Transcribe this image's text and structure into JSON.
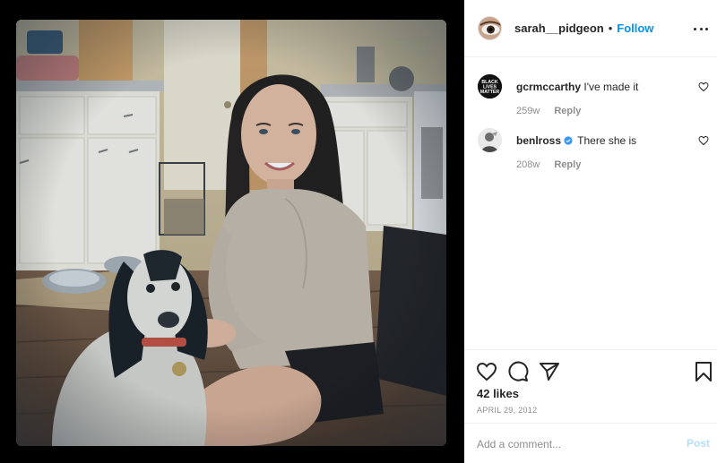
{
  "post": {
    "username": "sarah__pidgeon",
    "separator": "•",
    "follow_label": "Follow",
    "likes": "42 likes",
    "date": "APRIL 29, 2012"
  },
  "comments": [
    {
      "username": "gcrmccarthy",
      "text": "I've made it",
      "time": "259w",
      "reply_label": "Reply",
      "avatar_text": [
        "BLACK",
        "LIVES",
        "MATTER"
      ]
    },
    {
      "username": "benlross",
      "text": "There she is",
      "time": "208w",
      "reply_label": "Reply",
      "verified": true
    }
  ],
  "composer": {
    "placeholder": "Add a comment...",
    "post_label": "Post"
  },
  "icons": {
    "like": "heart-icon",
    "comment": "comment-icon",
    "share": "share-icon",
    "save": "bookmark-icon",
    "more": "more-options-icon",
    "verified": "verified-badge-icon"
  },
  "colors": {
    "accent": "#0095f6",
    "post_disabled": "#b2dffc",
    "muted": "#8e8e8e",
    "text": "#262626",
    "border": "#efefef"
  }
}
